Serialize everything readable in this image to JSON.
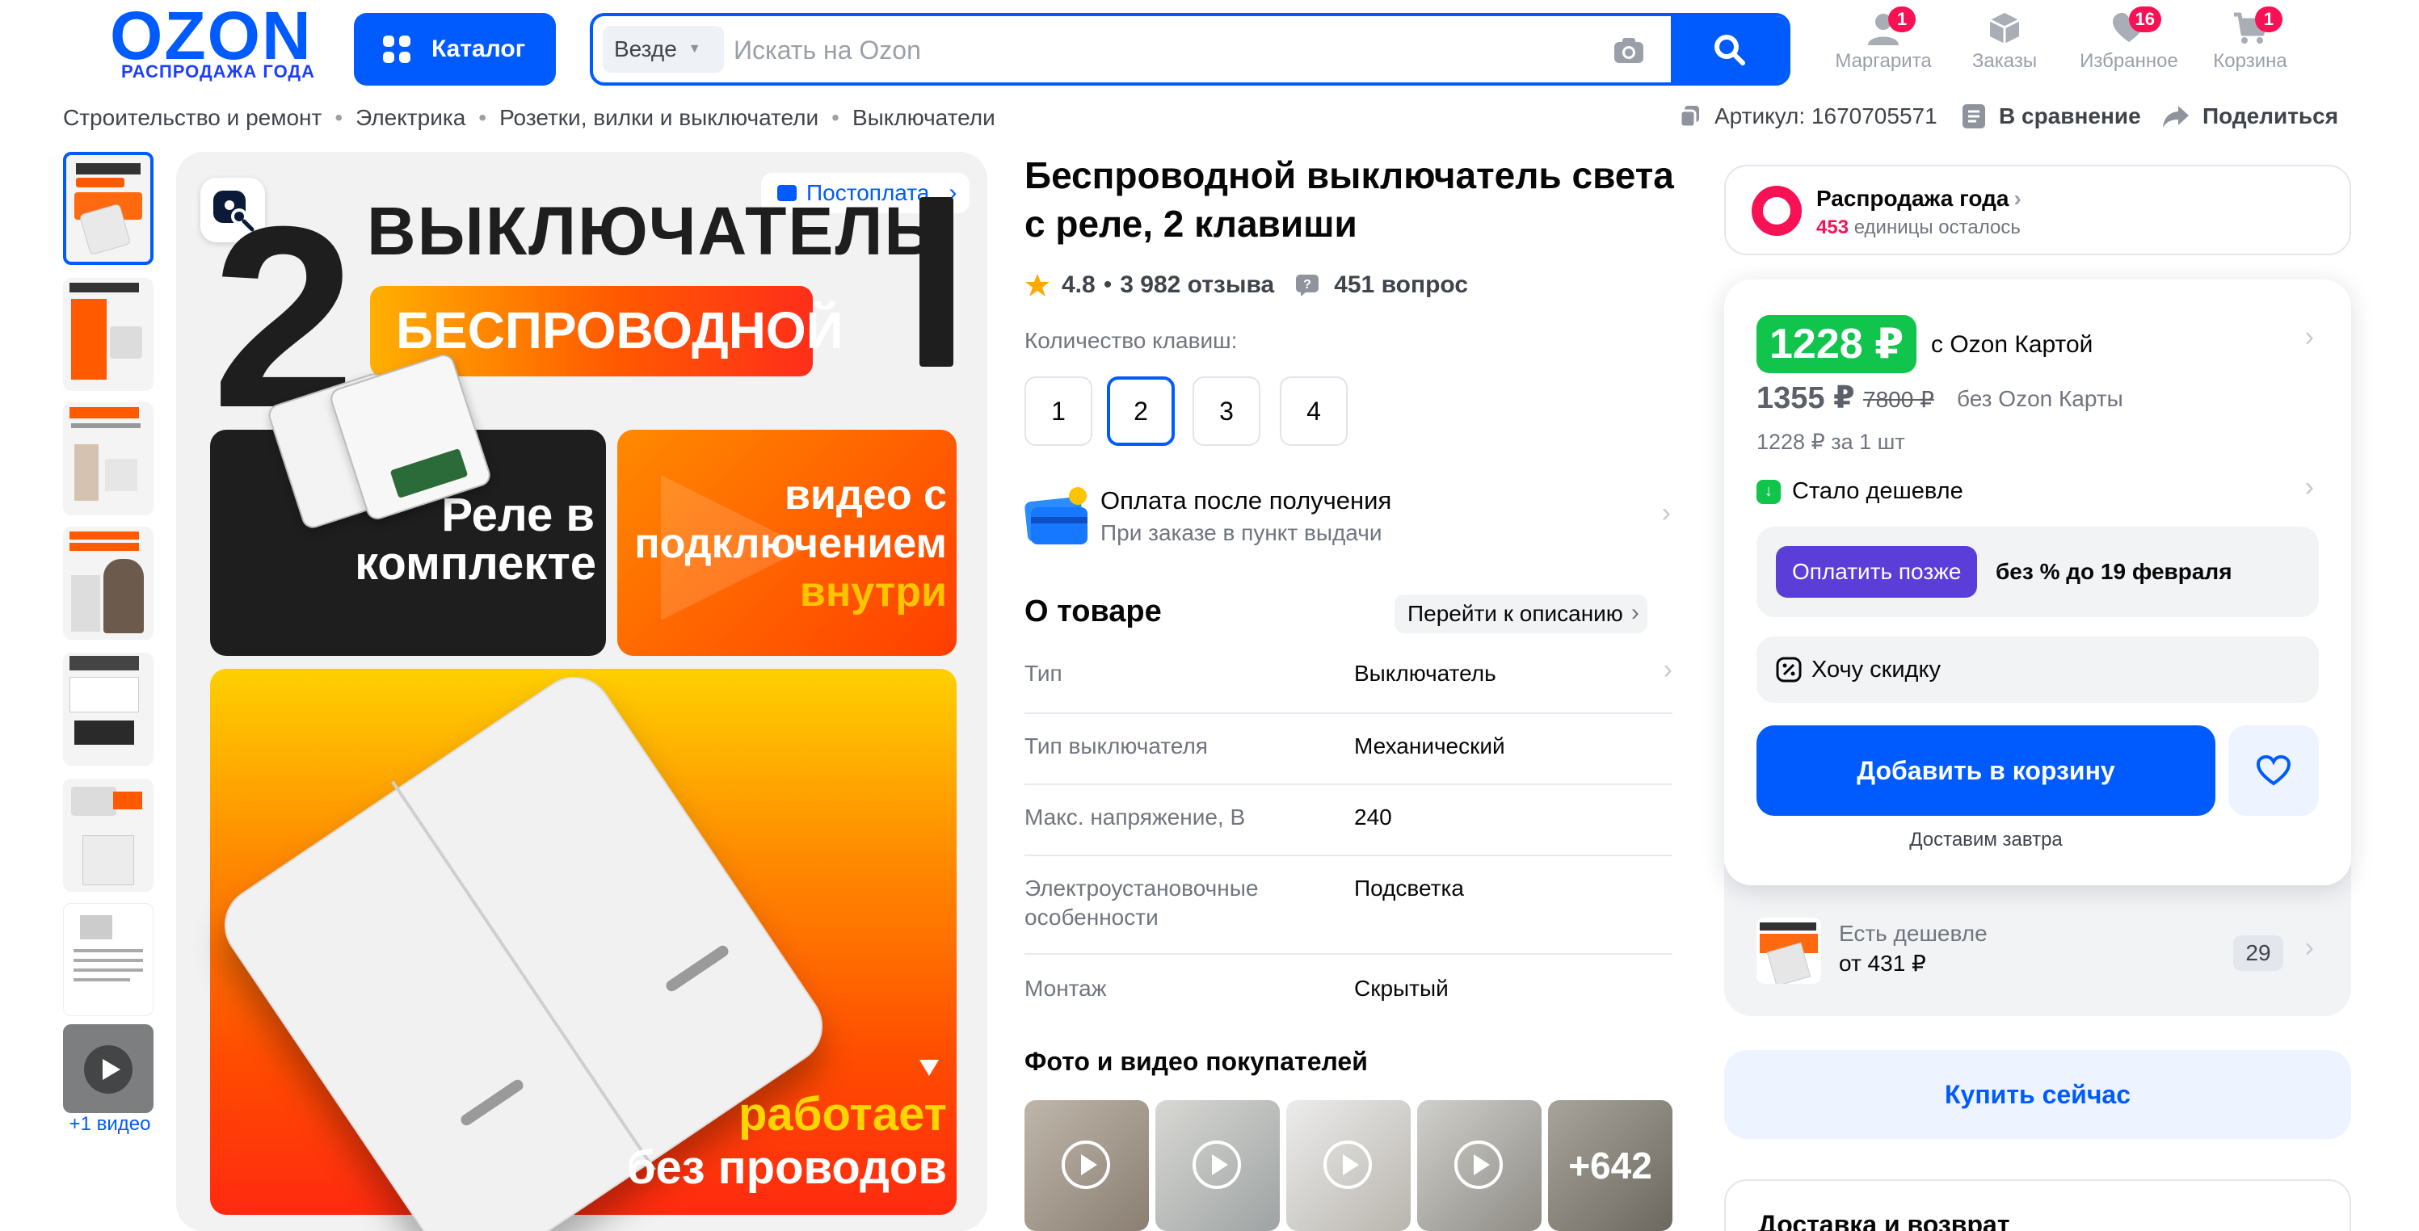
{
  "header": {
    "logo_text": "OZON",
    "logo_sale": "РАСПРОДАЖА ГОДА",
    "catalog_label": "Каталог",
    "search_scope": "Везде",
    "search_placeholder": "Искать на Ozon",
    "nav": [
      {
        "label": "Маргарита",
        "icon": "user-icon",
        "badge": "1"
      },
      {
        "label": "Заказы",
        "icon": "box-icon",
        "badge": ""
      },
      {
        "label": "Избранное",
        "icon": "heart-icon",
        "badge": "16"
      },
      {
        "label": "Корзина",
        "icon": "cart-icon",
        "badge": "1"
      }
    ]
  },
  "breadcrumbs": [
    "Строительство и ремонт",
    "Электрика",
    "Розетки, вилки и выключатели",
    "Выключатели"
  ],
  "top_actions": {
    "article": "Артикул: 1670705571",
    "compare": "В сравнение",
    "share": "Поделиться"
  },
  "gallery": {
    "video_caption": "+1 видео",
    "badge": "Постоплата",
    "image_text": {
      "big_num": "2",
      "switch_word": "ВЫКЛЮЧАТЕЛЬ",
      "wireless": "БЕСПРОВОДНОЙ",
      "relay_line1": "Реле в",
      "relay_line2": "комплекте",
      "video_line1": "видео с",
      "video_line2": "подключением",
      "video_line3": "внутри",
      "works_line1": "работает",
      "works_line2": "без проводов"
    }
  },
  "product": {
    "title": "Беспроводной выключатель света с реле, 2 клавиши",
    "rating": "4.8",
    "reviews": "3 982 отзыва",
    "questions": "451 вопрос",
    "keys_label": "Количество клавиш:",
    "keys": [
      "1",
      "2",
      "3",
      "4"
    ],
    "selected_key": "2",
    "pay_after_title": "Оплата после получения",
    "pay_after_sub": "При заказе в пункт выдачи",
    "about_title": "О товаре",
    "goto_description": "Перейти к описанию",
    "specs": [
      {
        "k": "Тип",
        "v": "Выключатель"
      },
      {
        "k": "Тип выключателя",
        "v": "Механический"
      },
      {
        "k": "Макс. напряжение, В",
        "v": "240"
      },
      {
        "k": "Электроустановочные особенности",
        "v": "Подсветка"
      },
      {
        "k": "Монтаж",
        "v": "Скрытый"
      }
    ],
    "ugc_title": "Фото и видео покупателей",
    "ugc_more": "+642"
  },
  "buybox": {
    "sale_title": "Распродажа года",
    "sale_count": "453",
    "sale_count_text": "единицы осталось",
    "price_card": "1228 ₽",
    "price_card_label": "с Ozon Картой",
    "price_regular": "1355 ₽",
    "price_old": "7800 ₽",
    "price_regular_label": "без Ozon Карты",
    "unit_price": "1228 ₽ за 1 шт",
    "cheaper_label": "Стало дешевле",
    "pay_later_btn": "Оплатить позже",
    "pay_later_text": "без % до 19 февраля",
    "want_discount": "Хочу скидку",
    "add_to_cart": "Добавить в корзину",
    "deliver": "Доставим завтра",
    "cheaper_elsewhere": "Есть дешевле",
    "cheaper_from": "от 431 ₽",
    "cheaper_count": "29",
    "buy_now": "Купить сейчас",
    "delivery_title": "Доставка и возврат"
  },
  "colors": {
    "brand": "#005bff",
    "green": "#10c44c",
    "pink": "#f91155",
    "orange": "#ff5a00"
  }
}
